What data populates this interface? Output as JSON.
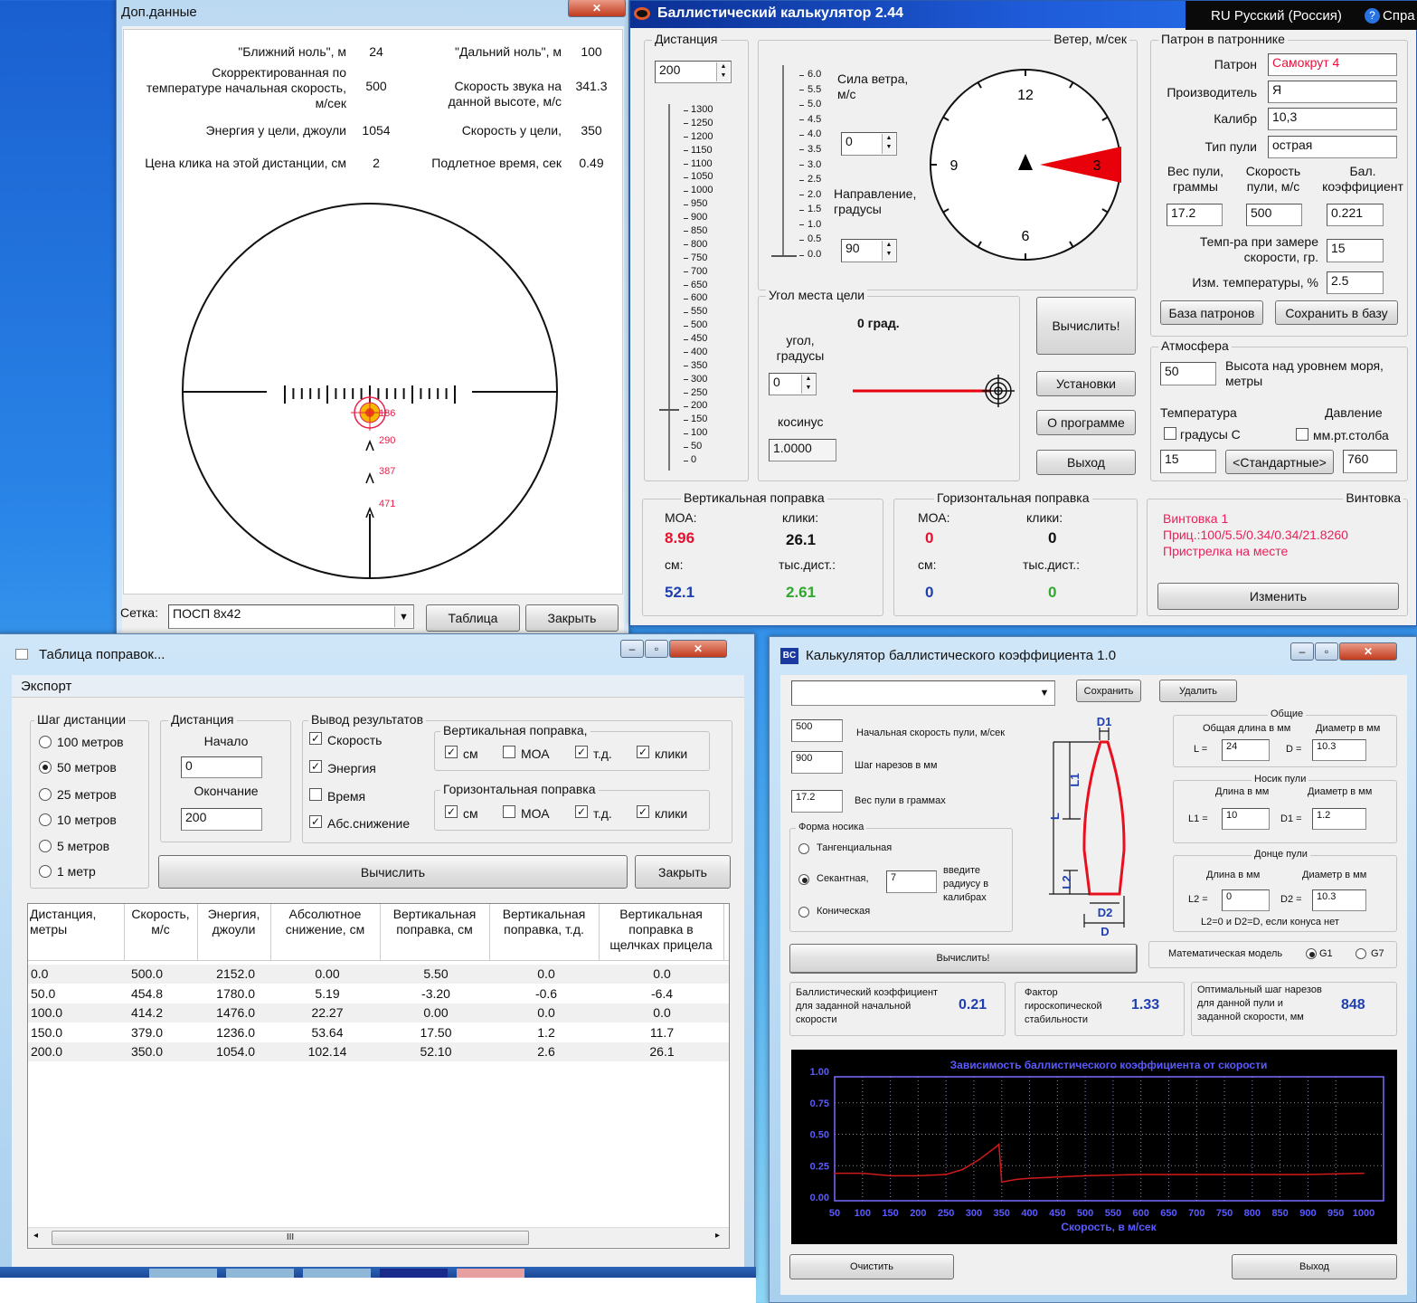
{
  "extra": {
    "title": "Доп.данные",
    "close": "✕",
    "near_zero_label": "\"Ближний ноль\", м",
    "near_zero": "24",
    "far_zero_label": "\"Дальний ноль\", м",
    "far_zero": "100",
    "corr_speed_label": [
      "Скорректированная по",
      "температуре начальная скорость,",
      "м/сек"
    ],
    "corr_speed": "500",
    "sound_label": [
      "Скорость звука на",
      "данной высоте, м/с"
    ],
    "sound": "341.3",
    "energy_label": "Энергия у цели, джоули",
    "energy": "1054",
    "target_speed_label": "Скорость у цели,",
    "target_speed": "350",
    "click_label": "Цена клика на этой дистанции, см",
    "click": "2",
    "flight_label": "Подлетное время, сек",
    "flight": "0.49",
    "reticle_marks": [
      "186",
      "290",
      "387",
      "471"
    ],
    "grid_label": "Сетка:",
    "grid_value": "ПОСП 8х42",
    "table_btn": "Таблица",
    "close_btn": "Закрыть"
  },
  "main": {
    "title": "Баллистический калькулятор 2.44",
    "lang": "RU Русский (Россия)",
    "help": "Спра",
    "distance": {
      "legend": "Дистанция",
      "value": "200",
      "scale": [
        "1300",
        "1250",
        "1200",
        "1150",
        "1100",
        "1050",
        "1000",
        "950",
        "900",
        "850",
        "800",
        "750",
        "700",
        "650",
        "600",
        "550",
        "500",
        "450",
        "400",
        "350",
        "300",
        "250",
        "200",
        "150",
        "100",
        "50",
        "0"
      ]
    },
    "wind": {
      "legend": "Ветер, м/сек",
      "scale": [
        "6.0",
        "5.5",
        "5.0",
        "4.5",
        "4.0",
        "3.5",
        "3.0",
        "2.5",
        "2.0",
        "1.5",
        "1.0",
        "0.5",
        "0.0"
      ],
      "force_label": [
        "Сила ветра,",
        "м/с"
      ],
      "force": "0",
      "dir_label": [
        "Направление,",
        "градусы"
      ],
      "dir": "90",
      "clock": [
        "12",
        "3",
        "6",
        "9"
      ],
      "arrow_color": "#e8000b"
    },
    "angle": {
      "legend": "Угол места цели",
      "deg": "0 град.",
      "angle_label": [
        "угол,",
        "градусы"
      ],
      "angle": "0",
      "cos_label": "косинус",
      "cos": "1.0000"
    },
    "buttons": {
      "calc": "Вычислить!",
      "settings": "Установки",
      "about": "О программе",
      "exit": "Выход"
    },
    "cartridge": {
      "legend": "Патрон в патроннике",
      "cart_label": "Патрон",
      "cart": "Самокрут 4",
      "maker_label": "Производитель",
      "maker": "Я",
      "cal_label": "Калибр",
      "cal": "10,3",
      "type_label": "Тип пули",
      "type": "острая",
      "weight_label": [
        "Вес пули,",
        "граммы"
      ],
      "weight": "17.2",
      "speed_label": [
        "Скорость",
        "пули, м/с"
      ],
      "speed": "500",
      "bc_label": [
        "Бал.",
        "коэффициент"
      ],
      "bc": "0.221",
      "temp_label": [
        "Темп-ра при замере",
        "скорости, гр."
      ],
      "temp": "15",
      "tchange_label": "Изм. температуры, %",
      "tchange": "2.5",
      "db_btn": "База патронов",
      "save_btn": "Сохранить в базу"
    },
    "atmo": {
      "legend": "Атмосфера",
      "alt": "50",
      "alt_label": [
        "Высота над уровнем моря,",
        "метры"
      ],
      "temp_title": "Температура",
      "temp_unit": "градусы С",
      "temp": "15",
      "std_btn": "<Стандартные>",
      "press_title": "Давление",
      "press_unit": "мм.рт.столба",
      "press": "760"
    },
    "vert": {
      "legend": "Вертикальная поправка",
      "moa_label": "МОА:",
      "moa": "8.96",
      "clicks_label": "клики:",
      "clicks": "26.1",
      "cm_label": "см:",
      "cm": "52.1",
      "mil_label": "тыс.дист.:",
      "mil": "2.61"
    },
    "horiz": {
      "legend": "Горизонтальная поправка",
      "moa_label": "МОА:",
      "moa": "0",
      "clicks_label": "клики:",
      "clicks": "0",
      "cm_label": "см:",
      "cm": "0",
      "mil_label": "тыс.дист.:",
      "mil": "0"
    },
    "rifle": {
      "legend": "Винтовка",
      "lines": [
        "Винтовка 1",
        "Приц.:100/5.5/0.34/0.34/21.8260",
        "Пристрелка на месте"
      ],
      "change_btn": "Изменить"
    }
  },
  "table": {
    "title": "Таблица поправок...",
    "menu_export": "Экспорт",
    "step_legend": "Шаг дистанции",
    "steps": [
      "100 метров",
      "50 метров",
      "25 метров",
      "10 метров",
      "5 метров",
      "1 метр"
    ],
    "step_selected": 1,
    "dist_legend": "Дистанция",
    "start_label": "Начало",
    "start": "0",
    "end_label": "Окончание",
    "end": "200",
    "out_legend": "Вывод результатов",
    "outputs": [
      {
        "label": "Скорость",
        "checked": true
      },
      {
        "label": "Энергия",
        "checked": true
      },
      {
        "label": "Время",
        "checked": false
      },
      {
        "label": "Абс.снижение",
        "checked": true
      }
    ],
    "vert_legend": "Вертикальная поправка,",
    "horiz_legend": "Горизонтальная поправка",
    "vert_opts": [
      {
        "label": "см",
        "checked": true
      },
      {
        "label": "МОА",
        "checked": false
      },
      {
        "label": "т.д.",
        "checked": true
      },
      {
        "label": "клики",
        "checked": true
      }
    ],
    "horiz_opts": [
      {
        "label": "см",
        "checked": true
      },
      {
        "label": "МОА",
        "checked": false
      },
      {
        "label": "т.д.",
        "checked": true
      },
      {
        "label": "клики",
        "checked": true
      }
    ],
    "calc_btn": "Вычислить",
    "close_btn": "Закрыть",
    "headers": [
      [
        "Дистанция,",
        "метры"
      ],
      [
        "Скорость,",
        "м/с"
      ],
      [
        "Энергия,",
        "джоули"
      ],
      [
        "Абсолютное",
        "снижение, см"
      ],
      [
        "Вертикальная",
        "поправка, см"
      ],
      [
        "Вертикальная",
        "поправка, т.д."
      ],
      [
        "Вертикальная",
        "поправка в",
        "щелчках прицела"
      ]
    ],
    "rows": [
      [
        "0.0",
        "500.0",
        "2152.0",
        "0.00",
        "5.50",
        "0.0",
        "0.0"
      ],
      [
        "50.0",
        "454.8",
        "1780.0",
        "5.19",
        "-3.20",
        "-0.6",
        "-6.4"
      ],
      [
        "100.0",
        "414.2",
        "1476.0",
        "22.27",
        "0.00",
        "0.0",
        "0.0"
      ],
      [
        "150.0",
        "379.0",
        "1236.0",
        "53.64",
        "17.50",
        "1.2",
        "11.7"
      ],
      [
        "200.0",
        "350.0",
        "1054.0",
        "102.14",
        "52.10",
        "2.6",
        "26.1"
      ]
    ],
    "scroll_grip": "III"
  },
  "bc": {
    "title": "Калькулятор баллистического коэффициента 1.0",
    "icon": "BC",
    "combo": "",
    "save_btn": "Сохранить",
    "delete_btn": "Удалить",
    "v0": "500",
    "v0_label": "Начальная скорость пули, м/сек",
    "twist": "900",
    "twist_label": "Шаг нарезов в мм",
    "weight": "17.2",
    "weight_label": "Вес пули в граммах",
    "nose_legend": "Форма носика",
    "nose_opts": [
      "Тангенциальная",
      "Секантная,",
      "Коническая"
    ],
    "nose_selected": 1,
    "radius": "7",
    "radius_label": [
      "введите",
      "радиусу в",
      "калибрах"
    ],
    "diagram": {
      "D1": "D1",
      "L1": "L1",
      "L": "L",
      "L2": "L2",
      "D2": "D2",
      "D": "D",
      "color": "#e8101e"
    },
    "general": {
      "legend": "Общие",
      "len_label": "Общая длина в мм",
      "dia_label": "Диаметр в мм",
      "L_label": "L =",
      "L": "24",
      "D_label": "D =",
      "D": "10.3"
    },
    "nose": {
      "legend": "Носик пули",
      "len_label": "Длина в мм",
      "dia_label": "Диаметр в мм",
      "L1_label": "L1 =",
      "L1": "10",
      "D1_label": "D1 =",
      "D1": "1.2"
    },
    "base": {
      "legend": "Донце пули",
      "len_label": "Длина в мм",
      "dia_label": "Диаметр в мм",
      "L2_label": "L2 =",
      "L2": "0",
      "D2_label": "D2 =",
      "D2": "10.3",
      "note": "L2=0 и D2=D, если конуса нет"
    },
    "calc_btn": "Вычислить!",
    "model_label": "Математическая модель",
    "models": [
      "G1",
      "G7"
    ],
    "model_selected": 0,
    "res_bc_label": [
      "Баллистический коэффициент",
      "для заданной начальной",
      "скорости"
    ],
    "res_bc": "0.21",
    "res_gyro_label": [
      "Фактор",
      "гироскопической",
      "стабильности"
    ],
    "res_gyro": "1.33",
    "res_twist_label": [
      "Оптимальный шаг нарезов",
      "для данной пули и",
      "заданной скорости, мм"
    ],
    "res_twist": "848",
    "clear_btn": "Очистить",
    "exit_btn": "Выход"
  },
  "chart_data": {
    "type": "line",
    "title": "Зависимость баллистического коэффициента от скорости",
    "xlabel": "Скорость, в м/сек",
    "ylabel": "",
    "xlim": [
      50,
      1000
    ],
    "ylim": [
      0,
      1
    ],
    "grid": true,
    "xticks": [
      "50",
      "100",
      "150",
      "200",
      "250",
      "300",
      "350",
      "400",
      "450",
      "500",
      "550",
      "600",
      "650",
      "700",
      "750",
      "800",
      "850",
      "900",
      "950",
      "1000"
    ],
    "yticks": [
      "0.00",
      "0.25",
      "0.50",
      "0.75",
      "1.00"
    ],
    "x": [
      50,
      100,
      150,
      200,
      250,
      280,
      310,
      340,
      345,
      350,
      375,
      400,
      450,
      500,
      550,
      600,
      700,
      800,
      900,
      1000
    ],
    "y": [
      0.19,
      0.19,
      0.17,
      0.17,
      0.18,
      0.22,
      0.3,
      0.4,
      0.42,
      0.12,
      0.14,
      0.15,
      0.16,
      0.17,
      0.175,
      0.18,
      0.18,
      0.18,
      0.18,
      0.19
    ],
    "colors": {
      "background": "#000000",
      "frame": "#7b6cff",
      "text": "#5a5aff",
      "line": "#d01a1a"
    }
  }
}
